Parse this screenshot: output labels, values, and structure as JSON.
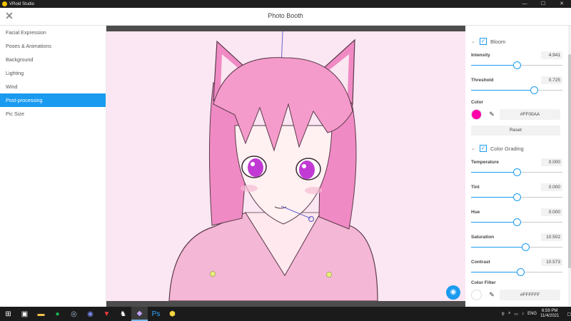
{
  "window": {
    "app_name": "VRoid Studio",
    "controls": [
      "—",
      "☐",
      "✕"
    ]
  },
  "header": {
    "title": "Photo Booth",
    "close_icon": "close-icon"
  },
  "left_menu": {
    "items": [
      {
        "label": "Facial Expression"
      },
      {
        "label": "Poses & Animations"
      },
      {
        "label": "Background"
      },
      {
        "label": "Lighting"
      },
      {
        "label": "Wind"
      },
      {
        "label": "Post-processing",
        "active": true
      },
      {
        "label": "Pic Size"
      }
    ]
  },
  "right_panel": {
    "bloom": {
      "label": "Bloom",
      "checked": true,
      "intensity": {
        "label": "Intensity",
        "value": "4.941",
        "fraction": 0.5
      },
      "threshold": {
        "label": "Threshold",
        "value": "0.725",
        "fraction": 0.69
      },
      "color": {
        "label": "Color",
        "hex": "#FF00AA",
        "swatch": "#FF00AA"
      },
      "reset_label": "Reset"
    },
    "color_grading": {
      "label": "Color Grading",
      "checked": true,
      "temperature": {
        "label": "Temperature",
        "value": "0.000",
        "fraction": 0.5
      },
      "tint": {
        "label": "Tint",
        "value": "0.000",
        "fraction": 0.5
      },
      "hue": {
        "label": "Hue",
        "value": "0.000",
        "fraction": 0.5
      },
      "saturation": {
        "label": "Saturation",
        "value": "10.502",
        "fraction": 0.59
      },
      "contrast": {
        "label": "Contrast",
        "value": "10.573",
        "fraction": 0.54
      },
      "color_filter": {
        "label": "Color Filter",
        "hex": "#FFFFFF",
        "swatch": "#FFFFFF"
      }
    }
  },
  "viewport": {
    "background_color": "#fbe6f3",
    "camera_icon": "camera-icon"
  },
  "taskbar": {
    "icons": [
      "windows-start-icon",
      "store-icon",
      "file-explorer-icon",
      "spotify-icon",
      "steam-icon",
      "discord-icon",
      "vivaldi-icon",
      "game-icon",
      "vroid-icon",
      "photoshop-icon",
      "app-yellow-icon"
    ],
    "tray": {
      "language": "ENG",
      "time": "6:59 PM",
      "date": "11/4/2021"
    }
  }
}
